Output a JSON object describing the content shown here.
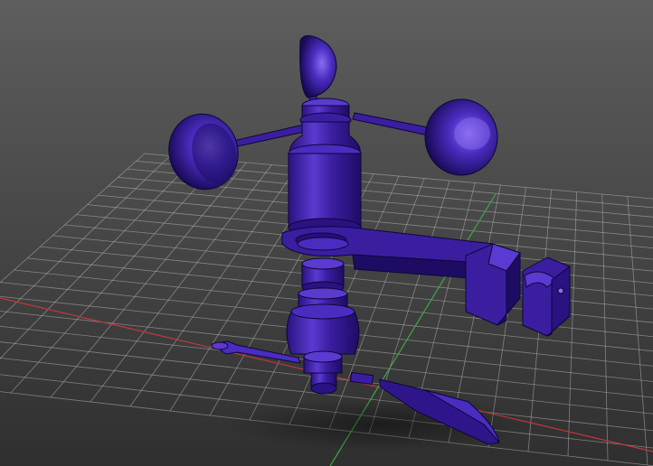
{
  "viewport": {
    "background_top": "#5e5e5e",
    "background_bottom": "#2f2f2f",
    "grid_color": "#bdbdbd",
    "x_axis_color": "#c0393b",
    "y_axis_color": "#3ea84a",
    "model_color": "#3b1ea0",
    "model_highlight": "#6a4be0",
    "model_shadow": "#1c0c5c",
    "edge_color": "#0e0636"
  },
  "model": {
    "parts": [
      "cup-top-icon",
      "cup-left-icon",
      "cup-right-icon",
      "rotor-hub-icon",
      "mount-arm-icon",
      "clamp-block-left-icon",
      "clamp-block-right-icon",
      "bearing-stack-icon",
      "vane-tail-icon",
      "vane-nose-icon"
    ]
  }
}
